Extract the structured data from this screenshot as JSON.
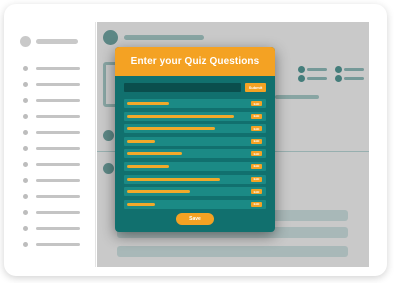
{
  "modal": {
    "title": "Enter your Quiz Questions",
    "input": {
      "value": "",
      "placeholder": ""
    },
    "submit_label": "Submit",
    "questions": [
      {
        "edit_label": "Edit"
      },
      {
        "edit_label": "Edit"
      },
      {
        "edit_label": "Edit"
      },
      {
        "edit_label": "Edit"
      },
      {
        "edit_label": "Edit"
      },
      {
        "edit_label": "Edit"
      },
      {
        "edit_label": "Edit"
      },
      {
        "edit_label": "Edit"
      },
      {
        "edit_label": "Edit"
      }
    ],
    "save_label": "Save"
  },
  "colors": {
    "accent_orange": "#f4a223",
    "teal_dark": "#11706e",
    "teal_row": "#1b8a85",
    "teal_input": "#0a4e4d"
  },
  "icons": {
    "background_image": "image-placeholder-icon",
    "avatar": "avatar-icon"
  }
}
